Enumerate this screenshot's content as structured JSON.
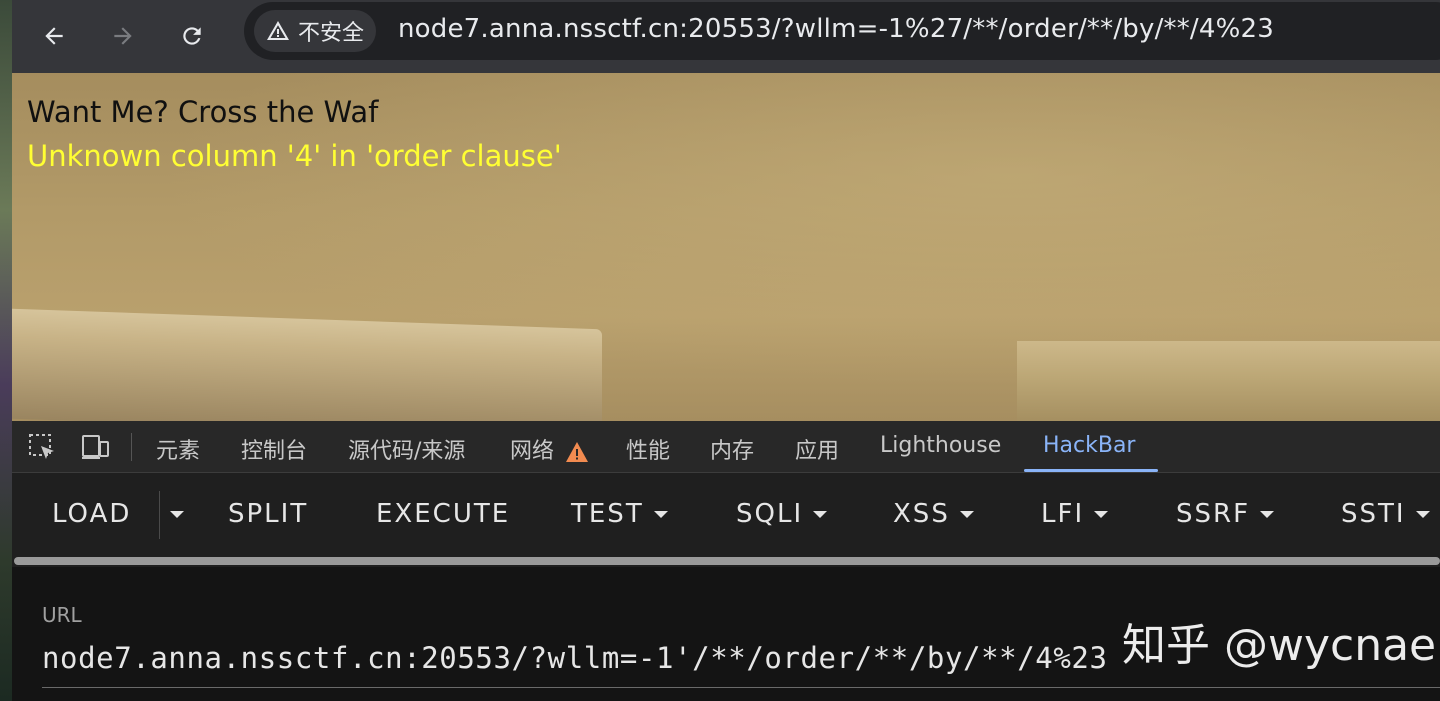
{
  "browser": {
    "security_label": "不安全",
    "address": "node7.anna.nssctf.cn:20553/?wllm=-1%27/**/order/**/by/**/4%23"
  },
  "page": {
    "heading": "Want Me? Cross the Waf",
    "error": "Unknown column '4' in 'order clause'"
  },
  "devtools": {
    "tabs": [
      {
        "label": "元素"
      },
      {
        "label": "控制台"
      },
      {
        "label": "源代码/来源"
      },
      {
        "label": "网络"
      },
      {
        "label": "性能"
      },
      {
        "label": "内存"
      },
      {
        "label": "应用"
      },
      {
        "label": "Lighthouse"
      },
      {
        "label": "HackBar"
      }
    ]
  },
  "hackbar": {
    "buttons": [
      "LOAD",
      "SPLIT",
      "EXECUTE",
      "TEST",
      "SQLI",
      "XSS",
      "LFI",
      "SSRF",
      "SSTI"
    ],
    "url_label": "URL",
    "url_value": "node7.anna.nssctf.cn:20553/?wllm=-1'/**/order/**/by/**/4%23"
  },
  "watermark": "知乎 @wycnae",
  "colors": {
    "error_text": "#ffff33",
    "active_tab": "#8ab4f8",
    "warning_icon": "#f28b50"
  }
}
